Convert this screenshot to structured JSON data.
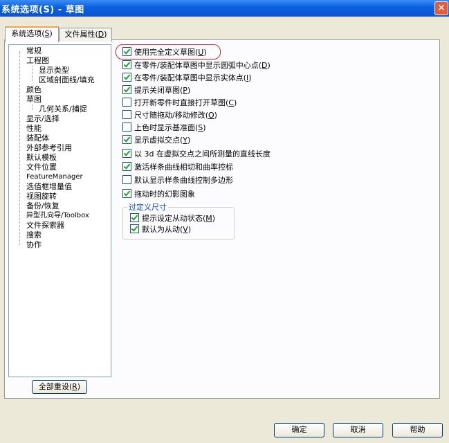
{
  "window": {
    "title": "系统选项(S) - 草图",
    "close_glyph": "✕"
  },
  "tabs": [
    {
      "label": "系统选项(",
      "key": "S",
      "suffix": ")"
    },
    {
      "label": "文件属性(",
      "key": "D",
      "suffix": ")"
    }
  ],
  "tree": {
    "items": [
      "常规",
      "工程图",
      "显示类型",
      "区域剖面线/填充",
      "颜色",
      "草图",
      "几何关系/捕捉",
      "显示/选择",
      "性能",
      "装配体",
      "外部参考引用",
      "默认模板",
      "文件位置",
      "FeatureManager",
      "选值框增量值",
      "视图旋转",
      "备份/恢复",
      "异型孔向导/Toolbox",
      "文件探索器",
      "搜索",
      "协作"
    ]
  },
  "reset_button": {
    "label": "全部重设(",
    "key": "R",
    "suffix": ")"
  },
  "options": [
    {
      "label": "使用完全定义草图(",
      "key": "U",
      "suffix": ")",
      "checked": true
    },
    {
      "label": "在零件/装配体草图中显示圆弧中心点(",
      "key": "D",
      "suffix": ")",
      "checked": true
    },
    {
      "label": "在零件/装配体草图中显示实体点(",
      "key": "I",
      "suffix": ")",
      "checked": true
    },
    {
      "label": "提示关闭草图(",
      "key": "P",
      "suffix": ")",
      "checked": true
    },
    {
      "label": "打开新零件时直接打开草图(",
      "key": "C",
      "suffix": ")",
      "checked": false
    },
    {
      "label": "尺寸随拖动/移动修改(",
      "key": "O",
      "suffix": ")",
      "checked": false
    },
    {
      "label": "上色时显示基准面(",
      "key": "S",
      "suffix": ")",
      "checked": false
    },
    {
      "label": "显示虚拟交点(",
      "key": "Y",
      "suffix": ")",
      "checked": true
    },
    {
      "label": "以 3d 在虚拟交点之间所测量的直线长度",
      "key": "",
      "suffix": "",
      "checked": true
    },
    {
      "label": "激活样条曲线相切和曲率控标",
      "key": "",
      "suffix": "",
      "checked": true
    },
    {
      "label": "默认显示样条曲线控制多边形",
      "key": "",
      "suffix": "",
      "checked": false
    },
    {
      "label": "拖动时的幻影图象",
      "key": "",
      "suffix": "",
      "checked": true
    }
  ],
  "group": {
    "title": "过定义尺寸",
    "options": [
      {
        "label": "提示设定从动状态(",
        "key": "M",
        "suffix": ")",
        "checked": true
      },
      {
        "label": "默认为从动(",
        "key": "V",
        "suffix": ")",
        "checked": true
      }
    ]
  },
  "buttons": {
    "ok": "确定",
    "cancel": "取消",
    "help": "帮助"
  }
}
